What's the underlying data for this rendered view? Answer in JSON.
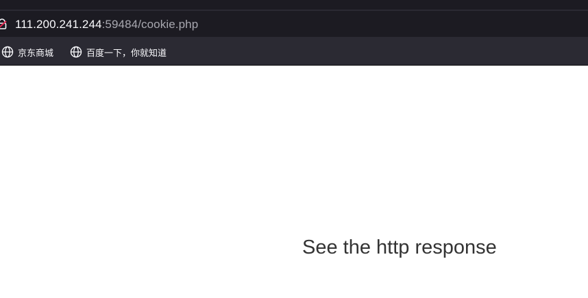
{
  "browser": {
    "url": {
      "host": "111.200.241.244",
      "rest": ":59484/cookie.php"
    },
    "bookmarks": [
      {
        "label": "京东商城",
        "icon": "globe-icon"
      },
      {
        "label": "百度一下，你就知道",
        "icon": "globe-icon"
      }
    ],
    "colors": {
      "tabstrip": "#1c1b22",
      "toolbar": "#2b2a33",
      "urlbar": "#1c1b22",
      "url_host": "#fbfbfe",
      "url_rest": "#a8a8b0",
      "lock_alert": "#e22850"
    }
  },
  "page": {
    "message": "See the http response",
    "text_color": "#333333",
    "background": "#ffffff"
  }
}
